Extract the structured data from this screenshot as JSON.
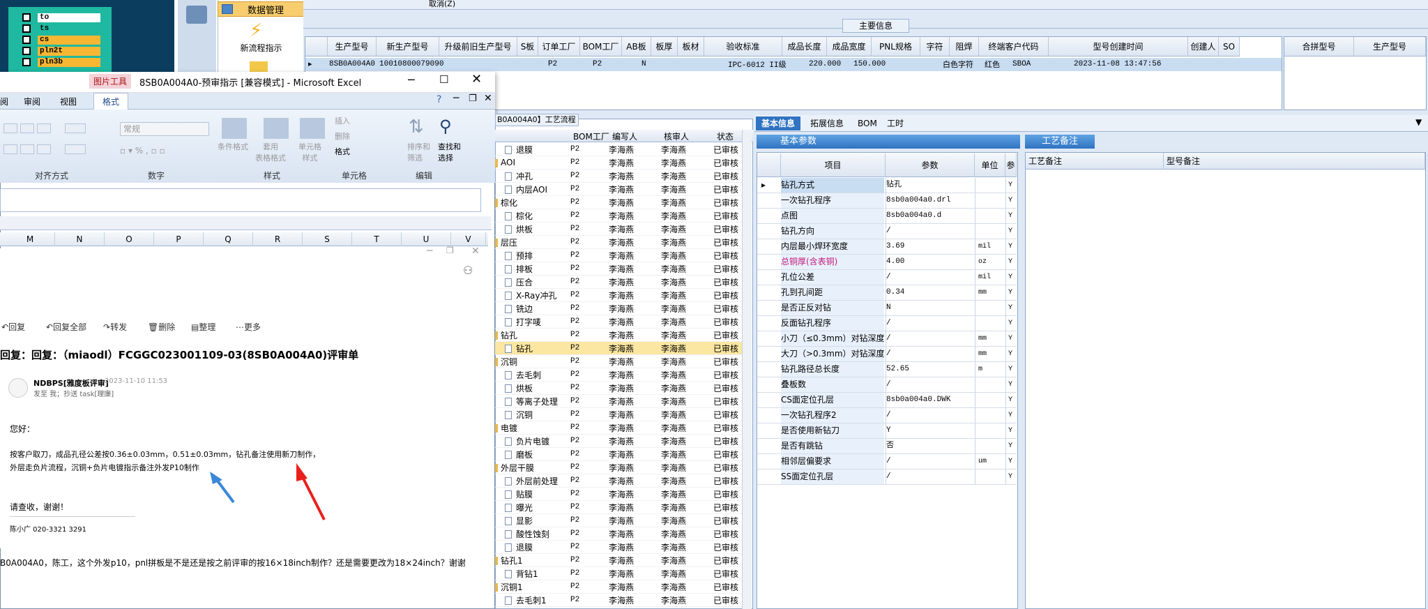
{
  "topstrip": {
    "items": [
      {
        "label": "to",
        "color": "#ffffff"
      },
      {
        "label": "ts",
        "color": "#1fb8a0"
      },
      {
        "label": "cs",
        "color": "#f7b733"
      },
      {
        "label": "pln2t",
        "color": "#f7b733"
      },
      {
        "label": "pln3b",
        "color": "#f7b733"
      }
    ]
  },
  "nav": {
    "header": "数据管理",
    "item": "新流程指示"
  },
  "app": {
    "top_cancel": "取消(Z)",
    "main_info_header": "主要信息",
    "grid_headers": [
      "生产型号",
      "新生产型号",
      "升级前旧生产型号",
      "S板",
      "订单工厂",
      "BOM工厂",
      "AB板",
      "板厚",
      "板材",
      "验收标准",
      "成品长度",
      "成品宽度",
      "PNL规格",
      "字符",
      "阻焊",
      "终端客户代码",
      "型号创建时间",
      "创建人",
      "SO"
    ],
    "row": {
      "prod": "8SB0A004A0",
      "newprod": "10010800079090",
      "factory": "P2",
      "bom": "P2",
      "ab": "N",
      "std": "IPC-6012 II级",
      "len": "220.000",
      "wid": "150.000",
      "char": "白色字符",
      "mask": "红色",
      "cust": "SBOA",
      "time": "2023-11-08 13:47:56"
    },
    "right_headers": [
      "合拼型号",
      "生产型号"
    ]
  },
  "excel": {
    "title": "8SB0A004A0-预审指示 [兼容模式] - Microsoft Excel",
    "pic_tool": "图片工具",
    "tabs": [
      "阅",
      "审阅",
      "视图",
      "格式"
    ],
    "ribbon": {
      "font_box": "常规",
      "insert": "插入",
      "delete": "删除",
      "format": "格式",
      "cond": "条件格式",
      "table": "套用\n表格格式",
      "cell": "单元格\n样式",
      "sort": "排序和\n筛选",
      "find": "查找和\n选择",
      "groups": [
        "对齐方式",
        "数字",
        "样式",
        "单元格",
        "编辑"
      ]
    },
    "cols": [
      "M",
      "N",
      "O",
      "P",
      "Q",
      "R",
      "S",
      "T",
      "U",
      "V"
    ]
  },
  "mail": {
    "toolbar": [
      "回复",
      "回复全部",
      "转发",
      "删除",
      "整理",
      "更多"
    ],
    "subject": "回复：回复：（miaodl）FCGGC023001109-03(8SB0A004A0)评审单",
    "sender": "NDBPS[雅度板评审]",
    "date": "2023-11-10 11:53",
    "to": "发至 我；抄送 task[理廉]",
    "greeting": "您好：",
    "line1": "按客户取刀，成品孔径公差按0.36±0.03mm，0.51±0.03mm，钻孔备注使用新刀制作，",
    "line2": "外层走负片流程，沉铜+负片电镀指示备注外发P10制作",
    "thanks": "请查收，谢谢！",
    "sig": "陈小广 020-3321 3291",
    "bottom": "B0A004A0，陈工，这个外发p10，pnl拼板是不是还是按之前评审的按16×18inch制作？还是需要更改为18×24inch？谢谢"
  },
  "process": {
    "tab": "B0A004A0】工艺流程",
    "headers": [
      "BOM工厂",
      "编写人",
      "核审人",
      "状态"
    ],
    "rows": [
      {
        "n": "退膜",
        "f": false,
        "b": "P2",
        "w": "李海燕",
        "c": "李海燕",
        "s": "已审核"
      },
      {
        "n": "AOI",
        "f": true,
        "b": "P2",
        "w": "李海燕",
        "c": "李海燕",
        "s": "已审核"
      },
      {
        "n": "冲孔",
        "f": false,
        "b": "P2",
        "w": "李海燕",
        "c": "李海燕",
        "s": "已审核"
      },
      {
        "n": "内层AOI",
        "f": false,
        "b": "P2",
        "w": "李海燕",
        "c": "李海燕",
        "s": "已审核"
      },
      {
        "n": "棕化",
        "f": true,
        "b": "P2",
        "w": "李海燕",
        "c": "李海燕",
        "s": "已审核"
      },
      {
        "n": "棕化",
        "f": false,
        "b": "P2",
        "w": "李海燕",
        "c": "李海燕",
        "s": "已审核"
      },
      {
        "n": "烘板",
        "f": false,
        "b": "P2",
        "w": "李海燕",
        "c": "李海燕",
        "s": "已审核"
      },
      {
        "n": "层压",
        "f": true,
        "b": "P2",
        "w": "李海燕",
        "c": "李海燕",
        "s": "已审核"
      },
      {
        "n": "预排",
        "f": false,
        "b": "P2",
        "w": "李海燕",
        "c": "李海燕",
        "s": "已审核"
      },
      {
        "n": "排板",
        "f": false,
        "b": "P2",
        "w": "李海燕",
        "c": "李海燕",
        "s": "已审核"
      },
      {
        "n": "压合",
        "f": false,
        "b": "P2",
        "w": "李海燕",
        "c": "李海燕",
        "s": "已审核"
      },
      {
        "n": "X-Ray冲孔",
        "f": false,
        "b": "P2",
        "w": "李海燕",
        "c": "李海燕",
        "s": "已审核"
      },
      {
        "n": "铣边",
        "f": false,
        "b": "P2",
        "w": "李海燕",
        "c": "李海燕",
        "s": "已审核"
      },
      {
        "n": "打字唛",
        "f": false,
        "b": "P2",
        "w": "李海燕",
        "c": "李海燕",
        "s": "已审核"
      },
      {
        "n": "钻孔",
        "f": true,
        "b": "P2",
        "w": "李海燕",
        "c": "李海燕",
        "s": "已审核"
      },
      {
        "n": "钻孔",
        "f": false,
        "b": "P2",
        "w": "李海燕",
        "c": "李海燕",
        "s": "已审核",
        "sel": true
      },
      {
        "n": "沉铜",
        "f": true,
        "b": "P2",
        "w": "李海燕",
        "c": "李海燕",
        "s": "已审核"
      },
      {
        "n": "去毛刺",
        "f": false,
        "b": "P2",
        "w": "李海燕",
        "c": "李海燕",
        "s": "已审核"
      },
      {
        "n": "烘板",
        "f": false,
        "b": "P2",
        "w": "李海燕",
        "c": "李海燕",
        "s": "已审核"
      },
      {
        "n": "等离子处理",
        "f": false,
        "b": "P2",
        "w": "李海燕",
        "c": "李海燕",
        "s": "已审核"
      },
      {
        "n": "沉铜",
        "f": false,
        "b": "P2",
        "w": "李海燕",
        "c": "李海燕",
        "s": "已审核"
      },
      {
        "n": "电镀",
        "f": true,
        "b": "P2",
        "w": "李海燕",
        "c": "李海燕",
        "s": "已审核"
      },
      {
        "n": "负片电镀",
        "f": false,
        "b": "P2",
        "w": "李海燕",
        "c": "李海燕",
        "s": "已审核"
      },
      {
        "n": "磨板",
        "f": false,
        "b": "P2",
        "w": "李海燕",
        "c": "李海燕",
        "s": "已审核"
      },
      {
        "n": "外层干膜",
        "f": true,
        "b": "P2",
        "w": "李海燕",
        "c": "李海燕",
        "s": "已审核"
      },
      {
        "n": "外层前处理",
        "f": false,
        "b": "P2",
        "w": "李海燕",
        "c": "李海燕",
        "s": "已审核"
      },
      {
        "n": "贴膜",
        "f": false,
        "b": "P2",
        "w": "李海燕",
        "c": "李海燕",
        "s": "已审核"
      },
      {
        "n": "曝光",
        "f": false,
        "b": "P2",
        "w": "李海燕",
        "c": "李海燕",
        "s": "已审核"
      },
      {
        "n": "显影",
        "f": false,
        "b": "P2",
        "w": "李海燕",
        "c": "李海燕",
        "s": "已审核"
      },
      {
        "n": "酸性蚀刻",
        "f": false,
        "b": "P2",
        "w": "李海燕",
        "c": "李海燕",
        "s": "已审核"
      },
      {
        "n": "退膜",
        "f": false,
        "b": "P2",
        "w": "李海燕",
        "c": "李海燕",
        "s": "已审核"
      },
      {
        "n": "钻孔1",
        "f": true,
        "b": "P2",
        "w": "李海燕",
        "c": "李海燕",
        "s": "已审核"
      },
      {
        "n": "背钻1",
        "f": false,
        "b": "P2",
        "w": "李海燕",
        "c": "李海燕",
        "s": "已审核"
      },
      {
        "n": "沉铜1",
        "f": true,
        "b": "P2",
        "w": "李海燕",
        "c": "李海燕",
        "s": "已审核"
      },
      {
        "n": "去毛刺1",
        "f": false,
        "b": "P2",
        "w": "李海燕",
        "c": "李海燕",
        "s": "已审核"
      }
    ]
  },
  "basic": {
    "tabs": [
      "基本信息",
      "拓展信息",
      "BOM",
      "工时"
    ],
    "header": "基本参数",
    "cols": [
      "项目",
      "参数",
      "单位",
      "参"
    ],
    "rows": [
      {
        "i": "钻孔方式",
        "p": "钻孔",
        "u": "",
        "f": "Y"
      },
      {
        "i": "一次钻孔程序",
        "p": "8sb0a004a0.drl",
        "u": "",
        "f": "Y"
      },
      {
        "i": "点图",
        "p": "8sb0a004a0.d",
        "u": "",
        "f": "Y"
      },
      {
        "i": "钻孔方向",
        "p": "/",
        "u": "",
        "f": "Y"
      },
      {
        "i": "内层最小焊环宽度",
        "p": "3.69",
        "u": "mil",
        "f": "Y"
      },
      {
        "i": "总铜厚(含表铜)",
        "p": "4.00",
        "u": "oz",
        "f": "Y",
        "pink": true
      },
      {
        "i": "孔位公差",
        "p": "/",
        "u": "mil",
        "f": "Y"
      },
      {
        "i": "孔到孔间距",
        "p": "0.34",
        "u": "mm",
        "f": "Y"
      },
      {
        "i": "是否正反对钻",
        "p": "N",
        "u": "",
        "f": "Y"
      },
      {
        "i": "反面钻孔程序",
        "p": "/",
        "u": "",
        "f": "Y"
      },
      {
        "i": "小刀（≤0.3mm）对钻深度",
        "p": "/",
        "u": "mm",
        "f": "Y"
      },
      {
        "i": "大刀（>0.3mm）对钻深度",
        "p": "/",
        "u": "mm",
        "f": "Y"
      },
      {
        "i": "钻孔路径总长度",
        "p": "52.65",
        "u": "m",
        "f": "Y"
      },
      {
        "i": "叠板数",
        "p": "/",
        "u": "",
        "f": "Y"
      },
      {
        "i": "CS面定位孔层",
        "p": "8sb0a004a0.DWK",
        "u": "",
        "f": "Y"
      },
      {
        "i": "一次钻孔程序2",
        "p": "/",
        "u": "",
        "f": "Y"
      },
      {
        "i": "是否使用新钻刀",
        "p": "Y",
        "u": "",
        "f": "Y"
      },
      {
        "i": "是否有跳钻",
        "p": "否",
        "u": "",
        "f": "Y"
      },
      {
        "i": "相邻层偏要求",
        "p": "/",
        "u": "um",
        "f": "Y"
      },
      {
        "i": "SS面定位孔层",
        "p": "/",
        "u": "",
        "f": "Y"
      }
    ]
  },
  "notes": {
    "header": "工艺备注",
    "cols": [
      "工艺备注",
      "型号备注"
    ]
  }
}
